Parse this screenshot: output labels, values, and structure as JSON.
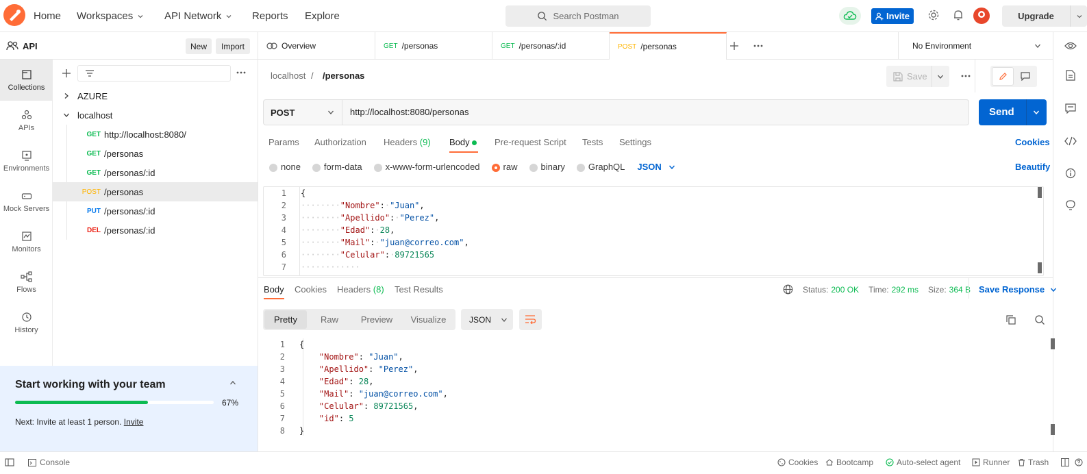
{
  "nav": {
    "home": "Home",
    "workspaces": "Workspaces",
    "api_network": "API Network",
    "reports": "Reports",
    "explore": "Explore",
    "search_placeholder": "Search Postman",
    "invite": "Invite",
    "upgrade": "Upgrade"
  },
  "workspace": {
    "name": "API",
    "new": "New",
    "import": "Import"
  },
  "rail": [
    "Collections",
    "APIs",
    "Environments",
    "Mock Servers",
    "Monitors",
    "Flows",
    "History"
  ],
  "tree": {
    "azure": "AZURE",
    "localhost": "localhost",
    "items": [
      {
        "method": "GET",
        "path": "http://localhost:8080/"
      },
      {
        "method": "GET",
        "path": "/personas"
      },
      {
        "method": "GET",
        "path": "/personas/:id"
      },
      {
        "method": "POST",
        "path": "/personas"
      },
      {
        "method": "PUT",
        "path": "/personas/:id"
      },
      {
        "method": "DEL",
        "path": "/personas/:id"
      }
    ]
  },
  "team": {
    "title": "Start working with your team",
    "progress_pct": "67%",
    "progress": 0.67,
    "next": "Next: Invite at least 1 person.",
    "invite_link": "Invite"
  },
  "tabs": [
    {
      "label": "Overview"
    },
    {
      "method": "GET",
      "label": "/personas"
    },
    {
      "method": "GET",
      "label": "/personas/:id"
    },
    {
      "method": "POST",
      "label": "/personas"
    }
  ],
  "environment": "No Environment",
  "breadcrumb": {
    "root": "localhost",
    "sep": "/",
    "current": "/personas"
  },
  "save": "Save",
  "request": {
    "method": "POST",
    "url": "http://localhost:8080/personas",
    "send": "Send"
  },
  "req_tabs": {
    "params": "Params",
    "authorization": "Authorization",
    "headers": "Headers",
    "headers_count": "(9)",
    "body": "Body",
    "prerequest": "Pre-request Script",
    "tests": "Tests",
    "settings": "Settings",
    "cookies": "Cookies"
  },
  "body_types": {
    "none": "none",
    "form_data": "form-data",
    "urlencoded": "x-www-form-urlencoded",
    "raw": "raw",
    "binary": "binary",
    "graphql": "GraphQL",
    "lang": "JSON",
    "beautify": "Beautify"
  },
  "request_body": [
    {
      "n": "1",
      "text": "{"
    },
    {
      "n": "2",
      "k": "\"Nombre\"",
      "v": "\"Juan\"",
      "t": "str",
      "c": ","
    },
    {
      "n": "3",
      "k": "\"Apellido\"",
      "v": "\"Perez\"",
      "t": "str",
      "c": ","
    },
    {
      "n": "4",
      "k": "\"Edad\"",
      "v": "28",
      "t": "num",
      "c": ","
    },
    {
      "n": "5",
      "k": "\"Mail\"",
      "v": "\"juan@correo.com\"",
      "t": "str",
      "c": ","
    },
    {
      "n": "6",
      "k": "\"Celular\"",
      "v": "89721565",
      "t": "num",
      "c": ""
    },
    {
      "n": "7",
      "text": ""
    }
  ],
  "resp_tabs": {
    "body": "Body",
    "cookies": "Cookies",
    "headers": "Headers",
    "headers_count": "(8)",
    "test_results": "Test Results"
  },
  "resp_meta": {
    "status_label": "Status:",
    "status": "200 OK",
    "time_label": "Time:",
    "time": "292 ms",
    "size_label": "Size:",
    "size": "364 B",
    "save_response": "Save Response"
  },
  "view_modes": {
    "pretty": "Pretty",
    "raw": "Raw",
    "preview": "Preview",
    "visualize": "Visualize",
    "format": "JSON"
  },
  "response_body": [
    {
      "n": "1",
      "text": "{"
    },
    {
      "n": "2",
      "k": "\"Nombre\"",
      "v": "\"Juan\"",
      "t": "str",
      "c": ","
    },
    {
      "n": "3",
      "k": "\"Apellido\"",
      "v": "\"Perez\"",
      "t": "str",
      "c": ","
    },
    {
      "n": "4",
      "k": "\"Edad\"",
      "v": "28",
      "t": "num",
      "c": ","
    },
    {
      "n": "5",
      "k": "\"Mail\"",
      "v": "\"juan@correo.com\"",
      "t": "str",
      "c": ","
    },
    {
      "n": "6",
      "k": "\"Celular\"",
      "v": "89721565",
      "t": "num",
      "c": ","
    },
    {
      "n": "7",
      "k": "\"id\"",
      "v": "5",
      "t": "num",
      "c": ""
    },
    {
      "n": "8",
      "text": "}"
    }
  ],
  "statusbar": {
    "console": "Console",
    "cookies": "Cookies",
    "bootcamp": "Bootcamp",
    "auto_select": "Auto-select agent",
    "runner": "Runner",
    "trash": "Trash"
  },
  "colors": {
    "brand": "#ff6c37",
    "primary": "#0265d2",
    "get": "#0cbb52",
    "post": "#ffb400",
    "put": "#097bed",
    "del": "#eb2013",
    "progress": "#0cbb52"
  }
}
